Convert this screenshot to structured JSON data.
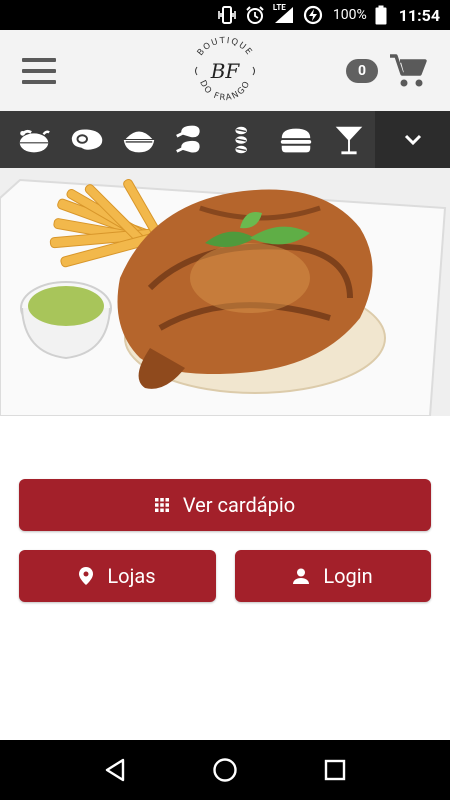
{
  "status_bar": {
    "battery_percent": "100%",
    "time": "11:54",
    "network_label": "LTE",
    "icons": [
      "vibrate-icon",
      "alarm-icon",
      "signal-icon",
      "data-saver-icon",
      "battery-icon"
    ]
  },
  "header": {
    "logo_monogram": "BF",
    "logo_top_text": "BOUTIQUE",
    "logo_bottom_text": "DO FRANGO",
    "cart_count": "0"
  },
  "categories": [
    {
      "icon": "whole-chicken-icon"
    },
    {
      "icon": "steak-icon"
    },
    {
      "icon": "rice-bowl-icon"
    },
    {
      "icon": "chicken-legs-icon"
    },
    {
      "icon": "skewers-icon"
    },
    {
      "icon": "burger-icon"
    },
    {
      "icon": "cocktail-icon"
    }
  ],
  "buttons": {
    "menu_label": "Ver cardápio",
    "stores_label": "Lojas",
    "login_label": "Login"
  },
  "colors": {
    "accent": "#a3202a",
    "category_bar": "#3a3a3a",
    "header_bg": "#f3f3f3"
  }
}
